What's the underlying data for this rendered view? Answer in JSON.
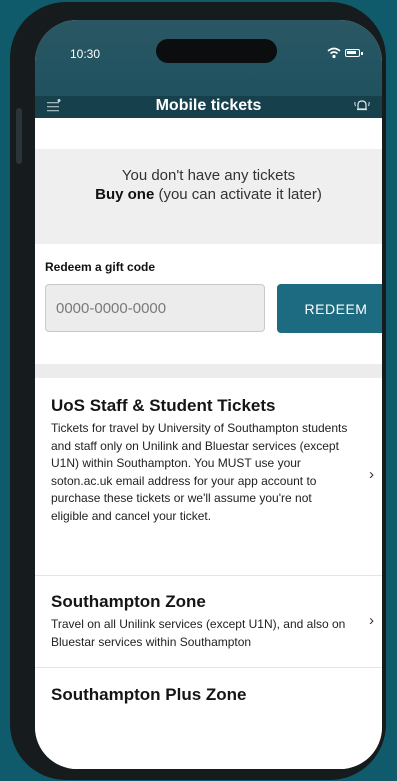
{
  "status_bar": {
    "time": "10:30"
  },
  "nav": {
    "title": "Mobile tickets",
    "menu_icon": "menu-icon",
    "alert_icon": "bell-icon"
  },
  "empty_state": {
    "line1": "You don't have any tickets",
    "buy_link": "Buy one",
    "line2_rest": " (you can activate it later)"
  },
  "gift": {
    "label": "Redeem a gift code",
    "placeholder": "0000-0000-0000",
    "value": "",
    "button": "REDEEM"
  },
  "tickets": [
    {
      "title": "UoS Staff & Student Tickets",
      "description": "Tickets for travel by University of Southampton students and staff only on Unilink and Bluestar services (except U1N) within Southampton. You MUST use your soton.ac.uk email address for your app account to purchase these tickets or we'll assume you're not eligible and cancel your ticket."
    },
    {
      "title": "Southampton Zone",
      "description": "Travel on all Unilink services (except U1N), and also on Bluestar services within Southampton"
    },
    {
      "title": "Southampton Plus Zone",
      "description": ""
    }
  ],
  "colors": {
    "background": "#0f5b6c",
    "header": "#16404c",
    "accent": "#1c6b80"
  }
}
